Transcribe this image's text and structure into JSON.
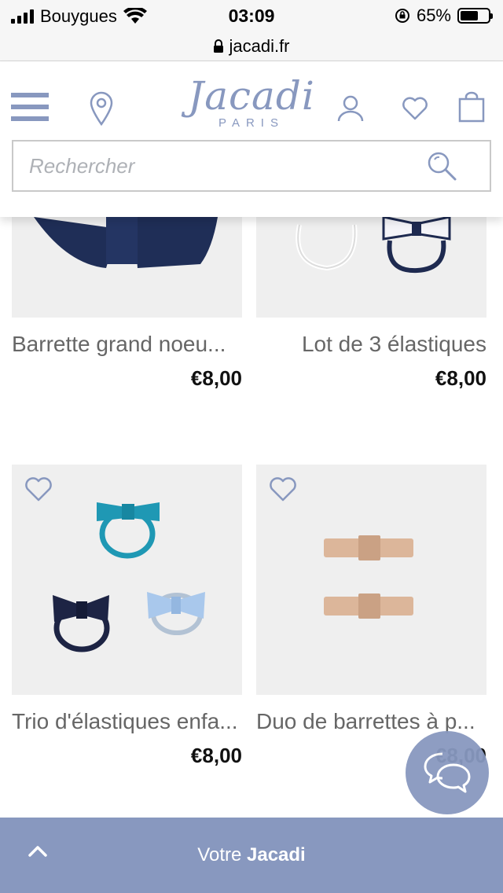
{
  "status_bar": {
    "carrier": "Bouygues",
    "time": "03:09",
    "battery": "65%",
    "battery_level": 0.65,
    "icons": [
      "signal-icon",
      "wifi-icon",
      "rotation-lock-icon",
      "battery-icon"
    ]
  },
  "browser": {
    "url": "jacadi.fr"
  },
  "header": {
    "logo_script": "Jacadi",
    "logo_sub": "PARIS",
    "icons": [
      "menu-icon",
      "store-locator-icon",
      "account-icon",
      "wishlist-icon",
      "cart-icon"
    ],
    "search_placeholder": "Rechercher"
  },
  "products": [
    {
      "name": "Barrette grand noeu...",
      "price": "€8,00"
    },
    {
      "name": "Lot de 3 élastiques",
      "price": "€8,00"
    },
    {
      "name": "Trio d'élastiques enfa...",
      "price": "€8,00"
    },
    {
      "name": "Duo de barrettes à p...",
      "price": "€8,00"
    }
  ],
  "footer_bar": {
    "prefix": "Votre",
    "brand": "Jacadi"
  },
  "colors": {
    "brand": "#8898bf",
    "tile_bg": "#efefef"
  }
}
